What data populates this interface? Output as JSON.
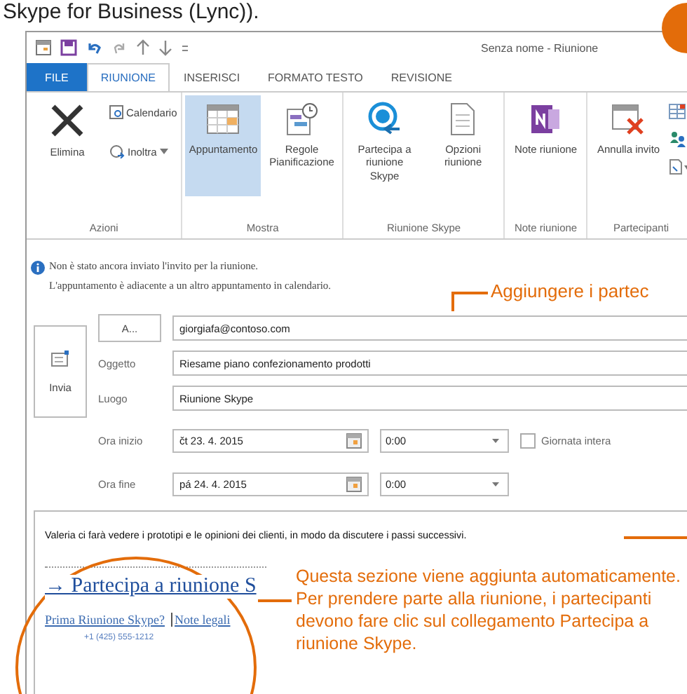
{
  "caption": "Skype for Business (Lync)).",
  "window": {
    "title": "Senza nome - Riunione"
  },
  "tabs": [
    {
      "label": "FILE",
      "kind": "file",
      "selected": false
    },
    {
      "label": "RIUNIONE",
      "kind": "tab",
      "selected": true
    },
    {
      "label": "INSERISCI",
      "kind": "tab",
      "selected": false
    },
    {
      "label": "FORMATO TESTO",
      "kind": "tab",
      "selected": false
    },
    {
      "label": "REVISIONE",
      "kind": "tab",
      "selected": false
    }
  ],
  "ribbon": [
    {
      "label": "Azioni",
      "buttons": [
        {
          "kind": "large",
          "label": "Elimina",
          "selected": false
        },
        {
          "kind": "small",
          "label": "Calendario",
          "selected": false
        },
        {
          "kind": "small",
          "label": "Inoltra",
          "selected": false
        }
      ]
    },
    {
      "label": "Mostra",
      "buttons": [
        {
          "kind": "large",
          "label": "Appuntamento",
          "selected": true
        },
        {
          "kind": "large",
          "label": "Regole Pianificazione",
          "selected": false
        }
      ]
    },
    {
      "label": "Riunione Skype",
      "buttons": [
        {
          "kind": "large",
          "label": "Partecipa a riunione Skype",
          "selected": false
        },
        {
          "kind": "large",
          "label": "Opzioni riunione",
          "selected": false
        }
      ]
    },
    {
      "label": "Note riunione",
      "buttons": [
        {
          "kind": "large",
          "label": "Note riunione",
          "selected": false
        }
      ]
    },
    {
      "label": "Partecipanti",
      "buttons": [
        {
          "kind": "large",
          "label": "Annulla invito",
          "selected": false
        },
        {
          "kind": "icon"
        }
      ]
    }
  ],
  "info": [
    "Non è stato ancora inviato l'invito per la riunione.",
    "L'appuntamento è adiacente a un altro appuntamento in calendario."
  ],
  "send_button": "Invia",
  "to_button": "A...",
  "to": "giorgiafa@contoso.com",
  "fields": [
    {
      "label": "Oggetto",
      "value": "Riesame piano confezionamento prodotti"
    },
    {
      "label": "Luogo",
      "value": "Riunione Skype"
    }
  ],
  "start": {
    "label": "Ora inizio",
    "date": "čt 23. 4. 2015",
    "time": "0:00"
  },
  "end": {
    "label": "Ora fine",
    "date": "pá 24. 4. 2015",
    "time": "0:00"
  },
  "all_day": {
    "label": "Giornata intera",
    "checked": false
  },
  "body": {
    "text": "Valeria ci farà vedere i prototipi e le opinioni dei clienti, in modo da discutere i passi successivi.",
    "join_link": "→ Partecipa a riunione S",
    "first_link": "Prima Riunione Skype?",
    "legal_link": "Note legali",
    "phone": "+1 (425) 555-1212"
  },
  "callouts": [
    "Aggiungere i partec",
    "Questa sezione viene aggiunta automaticamente. Per prendere parte alla riunione, i partecipanti devono fare clic sul collegamento Partecipa a riunione Skype."
  ]
}
